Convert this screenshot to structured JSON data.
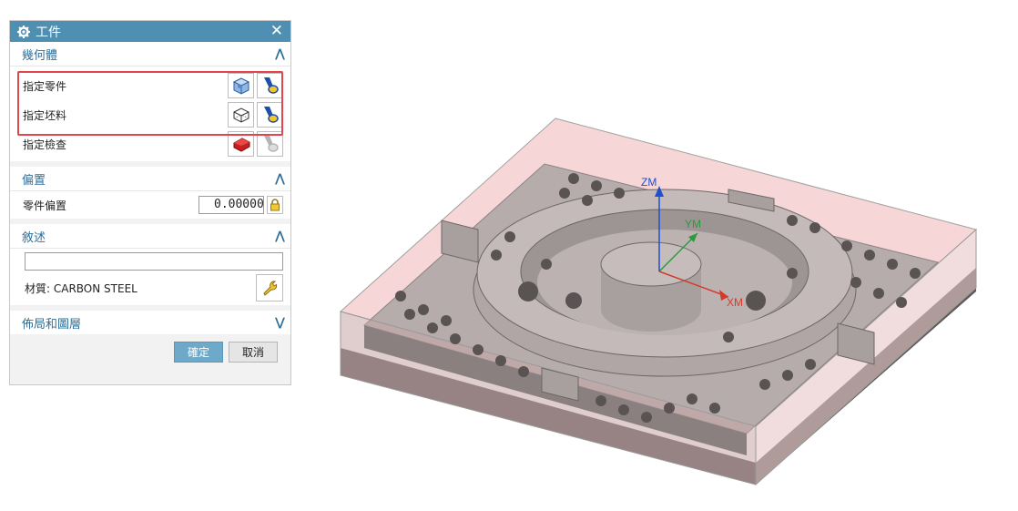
{
  "dialog": {
    "title": "工件",
    "geometry": {
      "header": "幾何體",
      "rows": [
        {
          "label": "指定零件"
        },
        {
          "label": "指定坯料"
        },
        {
          "label": "指定檢查"
        }
      ]
    },
    "offset": {
      "header": "偏置",
      "part_offset_label": "零件偏置",
      "part_offset_value": "0.00000"
    },
    "description": {
      "header": "敘述",
      "text_value": "",
      "material_label": "材質: CARBON STEEL"
    },
    "layout": {
      "header": "佈局和圖層"
    },
    "buttons": {
      "ok": "確定",
      "cancel": "取消"
    }
  },
  "viewport": {
    "axes": {
      "z": "ZM",
      "y": "YM",
      "x": "XM"
    },
    "colors": {
      "x": "#d23a2a",
      "y": "#2a9a3a",
      "z": "#1f4fd0",
      "blank": "#f4d0d0",
      "part": "#a39a9a"
    }
  }
}
